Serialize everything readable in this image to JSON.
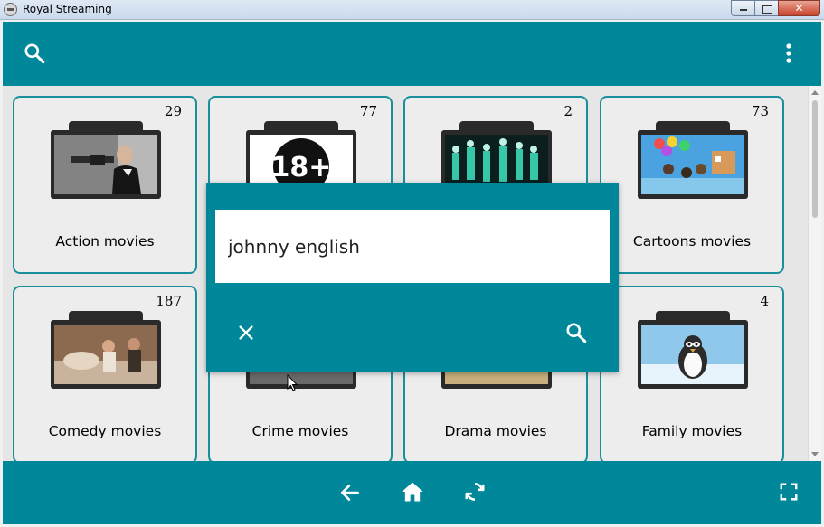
{
  "window": {
    "title": "Royal Streaming"
  },
  "toolbar": {
    "search_icon": "search-icon",
    "menu_icon": "more-vert-icon"
  },
  "categories": [
    {
      "label": "Action movies",
      "count": "29"
    },
    {
      "label": "",
      "count": "77"
    },
    {
      "label": "",
      "count": "2"
    },
    {
      "label": "Cartoons movies",
      "count": "73"
    },
    {
      "label": "Comedy movies",
      "count": "187"
    },
    {
      "label": "Crime movies",
      "count": ""
    },
    {
      "label": "Drama movies",
      "count": ""
    },
    {
      "label": "Family movies",
      "count": "4"
    }
  ],
  "search_dialog": {
    "value": "johnny english",
    "close_icon": "close-icon",
    "search_icon": "search-icon"
  },
  "bottom_nav": {
    "back_icon": "arrow-back-icon",
    "home_icon": "home-icon",
    "refresh_icon": "refresh-icon",
    "fullscreen_icon": "fullscreen-icon"
  },
  "colors": {
    "primary": "#00889a",
    "card_border": "#1a8f9c"
  },
  "badges": {
    "adult": "18+"
  }
}
